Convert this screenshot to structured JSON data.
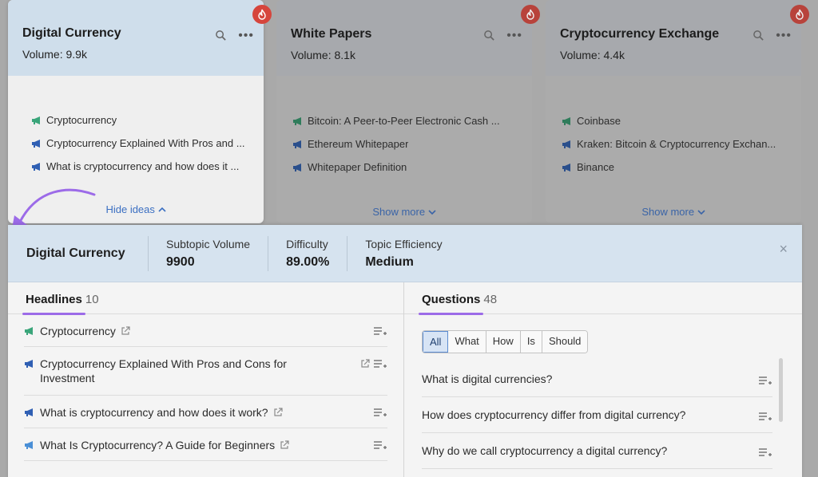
{
  "cards": [
    {
      "title": "Digital Currency",
      "volume": "Volume: 9.9k",
      "items": [
        {
          "text": "Cryptocurrency",
          "icon": "megaphone-green-icon"
        },
        {
          "text": "Cryptocurrency Explained With Pros and ...",
          "icon": "megaphone-blue-icon"
        },
        {
          "text": "What is cryptocurrency and how does it ...",
          "icon": "megaphone-blue-icon"
        }
      ],
      "footer": "Hide ideas"
    },
    {
      "title": "White Papers",
      "volume": "Volume: 8.1k",
      "items": [
        {
          "text": "Bitcoin: A Peer-to-Peer Electronic Cash ...",
          "icon": "megaphone-green-icon"
        },
        {
          "text": "Ethereum Whitepaper",
          "icon": "megaphone-blue-icon"
        },
        {
          "text": "Whitepaper Definition",
          "icon": "megaphone-blue-icon"
        }
      ],
      "footer": "Show more"
    },
    {
      "title": "Cryptocurrency Exchange",
      "volume": "Volume: 4.4k",
      "items": [
        {
          "text": "Coinbase",
          "icon": "megaphone-green-icon"
        },
        {
          "text": "Kraken: Bitcoin & Cryptocurrency Exchan...",
          "icon": "megaphone-blue-icon"
        },
        {
          "text": "Binance",
          "icon": "megaphone-blue-icon"
        }
      ],
      "footer": "Show more"
    }
  ],
  "panel": {
    "title": "Digital Currency",
    "stats": [
      {
        "label": "Subtopic Volume",
        "value": "9900"
      },
      {
        "label": "Difficulty",
        "value": "89.00%"
      },
      {
        "label": "Topic Efficiency",
        "value": "Medium"
      }
    ],
    "close": "×",
    "headlines": {
      "label": "Headlines",
      "count": "10",
      "items": [
        {
          "text": "Cryptocurrency",
          "icon": "megaphone-green-icon"
        },
        {
          "text": "Cryptocurrency Explained With Pros and Cons for Investment",
          "icon": "megaphone-blue-icon"
        },
        {
          "text": "What is cryptocurrency and how does it work?",
          "icon": "megaphone-blue-icon"
        },
        {
          "text": "What Is Cryptocurrency? A Guide for Beginners",
          "icon": "megaphone-lightblue-icon"
        }
      ]
    },
    "questions": {
      "label": "Questions",
      "count": "48",
      "filters": [
        "All",
        "What",
        "How",
        "Is",
        "Should"
      ],
      "active_filter": "All",
      "items": [
        "What is digital currencies?",
        "How does cryptocurrency differ from digital currency?",
        "Why do we call cryptocurrency a digital currency?"
      ]
    }
  },
  "colors": {
    "accent_purple": "#9c6be8",
    "link_blue": "#3b6fc2",
    "badge_red": "#d6453c",
    "megaphone_green": "#3aa57a",
    "megaphone_blue": "#2f5fb3"
  }
}
